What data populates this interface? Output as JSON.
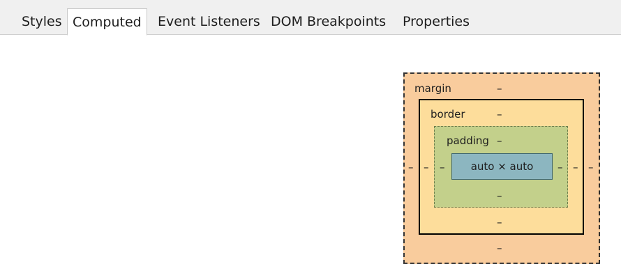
{
  "tabs": [
    {
      "label": "Styles",
      "active": false
    },
    {
      "label": "Computed",
      "active": true
    },
    {
      "label": "Event Listeners",
      "active": false
    },
    {
      "label": "DOM Breakpoints",
      "active": false
    },
    {
      "label": "Properties",
      "active": false
    }
  ],
  "box_model": {
    "margin": {
      "label": "margin",
      "top": "–",
      "right": "–",
      "bottom": "–",
      "left": "–"
    },
    "border": {
      "label": "border",
      "top": "–",
      "right": "–",
      "bottom": "–",
      "left": "–"
    },
    "padding": {
      "label": "padding",
      "top": "–",
      "right": "–",
      "bottom": "–",
      "left": "–"
    },
    "content": {
      "size": "auto × auto"
    }
  },
  "colors": {
    "margin": "#f9cc9d",
    "border": "#fddd9b",
    "padding": "#c3d08b",
    "content": "#8cb6c0"
  }
}
